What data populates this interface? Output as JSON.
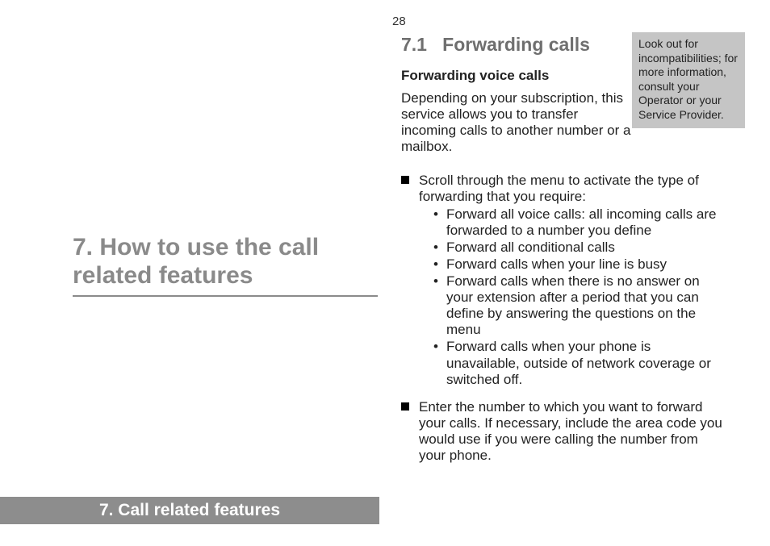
{
  "page_number": "28",
  "left": {
    "chapter_number": "7.",
    "chapter_title": "How to use the call related features"
  },
  "footer": {
    "label": "7. Call related features"
  },
  "section": {
    "number": "7.1",
    "title": "Forwarding calls"
  },
  "subheading": "Forwarding voice calls",
  "paragraph": "Depending on your subscription, this service allows you to transfer incoming calls to another number or a mailbox.",
  "sidebox": "Look out for incompatibilities; for more information, consult your Operator or your Service Provider.",
  "steps": [
    {
      "text": "Scroll through the menu to activate the type of forwarding that you require:",
      "sub": [
        "Forward all voice calls: all incoming calls are forwarded to a number you define",
        "Forward all conditional calls",
        "Forward calls when your line is busy",
        "Forward calls when there is no answer on your extension after a period that you can define by answering the questions on the menu",
        "Forward calls when your phone is unavailable, outside of network coverage or switched off."
      ]
    },
    {
      "text": "Enter the number to which you want to forward your calls. If necessary, include the area code you would use if you were calling the number from your phone.",
      "sub": []
    }
  ]
}
